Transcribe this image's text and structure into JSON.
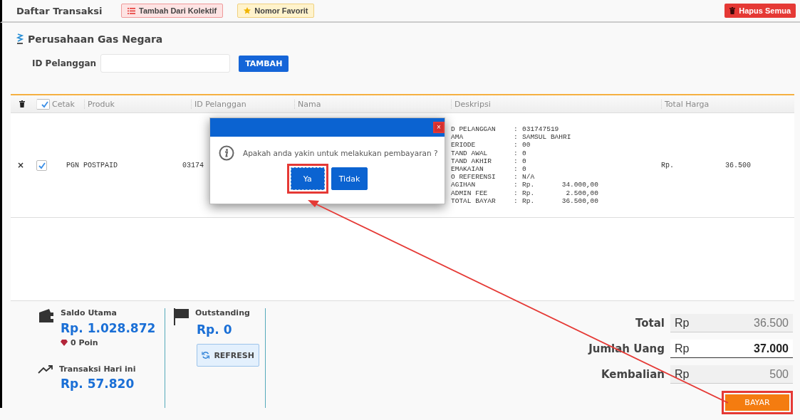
{
  "header": {
    "title": "Daftar Transaksi",
    "kolektif_button": "Tambah Dari Kolektif",
    "favorit_button": "Nomor Favorit",
    "delete_all_button": "Hapus Semua"
  },
  "provider": {
    "name": "Perusahaan Gas Negara",
    "id_label": "ID Pelanggan",
    "add_button": "TAMBAH"
  },
  "table": {
    "print_all_checked": true,
    "columns": [
      "Cetak",
      "Produk",
      "ID Pelanggan",
      "Nama",
      "Deskripsi",
      "Total Harga"
    ],
    "rows": [
      {
        "remove": "×",
        "print": true,
        "produk": "PGN POSTPAID",
        "id_pelanggan": "03174",
        "currency": "Rp.",
        "total": "36.500",
        "deskripsi": [
          {
            "label": "D PELANGGAN",
            "colon": ":",
            "value": "031747519"
          },
          {
            "label": "AMA",
            "colon": ":",
            "value": "SAMSUL BAHRI"
          },
          {
            "label": "ERIODE",
            "colon": ":",
            "value": "00"
          },
          {
            "label": "TAND AWAL",
            "colon": ":",
            "value": "0"
          },
          {
            "label": "TAND AKHIR",
            "colon": ":",
            "value": "0"
          },
          {
            "label": "EMAKAIAN",
            "colon": ":",
            "value": "0"
          },
          {
            "label": "O REFERENSI",
            "colon": ":",
            "value": "N/A"
          },
          {
            "label": "AGIHAN",
            "colon": ":",
            "value": "Rp.",
            "amount": "34.000,00"
          },
          {
            "label": "ADMIN FEE",
            "colon": ":",
            "value": "Rp.",
            "amount": "2.500,00"
          },
          {
            "label": "TOTAL BAYAR",
            "colon": ":",
            "value": "Rp.",
            "amount": "36.500,00"
          }
        ]
      }
    ]
  },
  "balance": {
    "saldo_label": "Saldo Utama",
    "saldo_value": "Rp. 1.028.872",
    "poin": "0 Poin",
    "today_label": "Transaksi Hari ini",
    "today_value": "Rp. 57.820",
    "outstanding_label": "Outstanding",
    "outstanding_value": "Rp. 0",
    "refresh_button": "REFRESH"
  },
  "payment": {
    "fields": [
      {
        "label": "Total",
        "currency": "Rp",
        "value": "36.500",
        "editable": false
      },
      {
        "label": "Jumlah Uang",
        "currency": "Rp",
        "value": "37.000",
        "editable": true
      },
      {
        "label": "Kembalian",
        "currency": "Rp",
        "value": "500",
        "editable": false
      }
    ],
    "pay_button": "BAYAR"
  },
  "dialog": {
    "close": "×",
    "message": "Apakah anda yakin untuk melakukan pembayaran ?",
    "buttons": [
      {
        "label": "Ya",
        "focused": true
      },
      {
        "label": "Tidak",
        "focused": false
      }
    ]
  }
}
